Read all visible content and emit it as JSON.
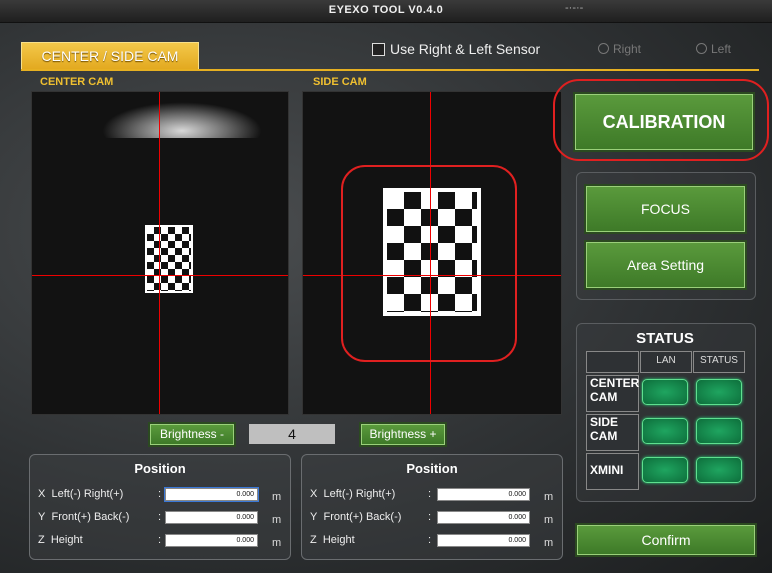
{
  "window": {
    "title": "EYEXO TOOL V0.4.0",
    "extra": "-·-·-"
  },
  "tab": {
    "label": "CENTER / SIDE CAM"
  },
  "sensor": {
    "checkbox_label": "Use Right & Left Sensor",
    "right_label": "Right",
    "left_label": "Left"
  },
  "cams": {
    "center_label": "CENTER CAM",
    "side_label": "SIDE CAM"
  },
  "brightness": {
    "minus_label": "Brightness -",
    "value": "4",
    "plus_label": "Brightness +"
  },
  "position_center": {
    "title": "Position",
    "rows": [
      {
        "axis": "X",
        "label": "Left(-) Right(+)",
        "value": "0.000",
        "unit": "m"
      },
      {
        "axis": "Y",
        "label": "Front(+) Back(-)",
        "value": "0.000",
        "unit": "m"
      },
      {
        "axis": "Z",
        "label": "Height",
        "value": "0.000",
        "unit": "m"
      }
    ]
  },
  "position_side": {
    "title": "Position",
    "rows": [
      {
        "axis": "X",
        "label": "Left(-) Right(+)",
        "value": "0.000",
        "unit": "m"
      },
      {
        "axis": "Y",
        "label": "Front(+) Back(-)",
        "value": "0.000",
        "unit": "m"
      },
      {
        "axis": "Z",
        "label": "Height",
        "value": "0.000",
        "unit": "m"
      }
    ]
  },
  "buttons": {
    "calibration": "CALIBRATION",
    "focus": "FOCUS",
    "area_setting": "Area Setting",
    "confirm": "Confirm"
  },
  "status": {
    "title": "STATUS",
    "col_lan": "LAN",
    "col_status": "STATUS",
    "rows": [
      {
        "name_l1": "CENTER",
        "name_l2": "CAM"
      },
      {
        "name_l1": "SIDE",
        "name_l2": "CAM"
      },
      {
        "name_l1": "XMINI",
        "name_l2": ""
      }
    ]
  },
  "colors": {
    "accent_yellow": "#e6b022",
    "button_green": "#4a8a32",
    "crosshair": "#e00000",
    "highlight": "#e02020",
    "led_green": "#1fa560"
  }
}
